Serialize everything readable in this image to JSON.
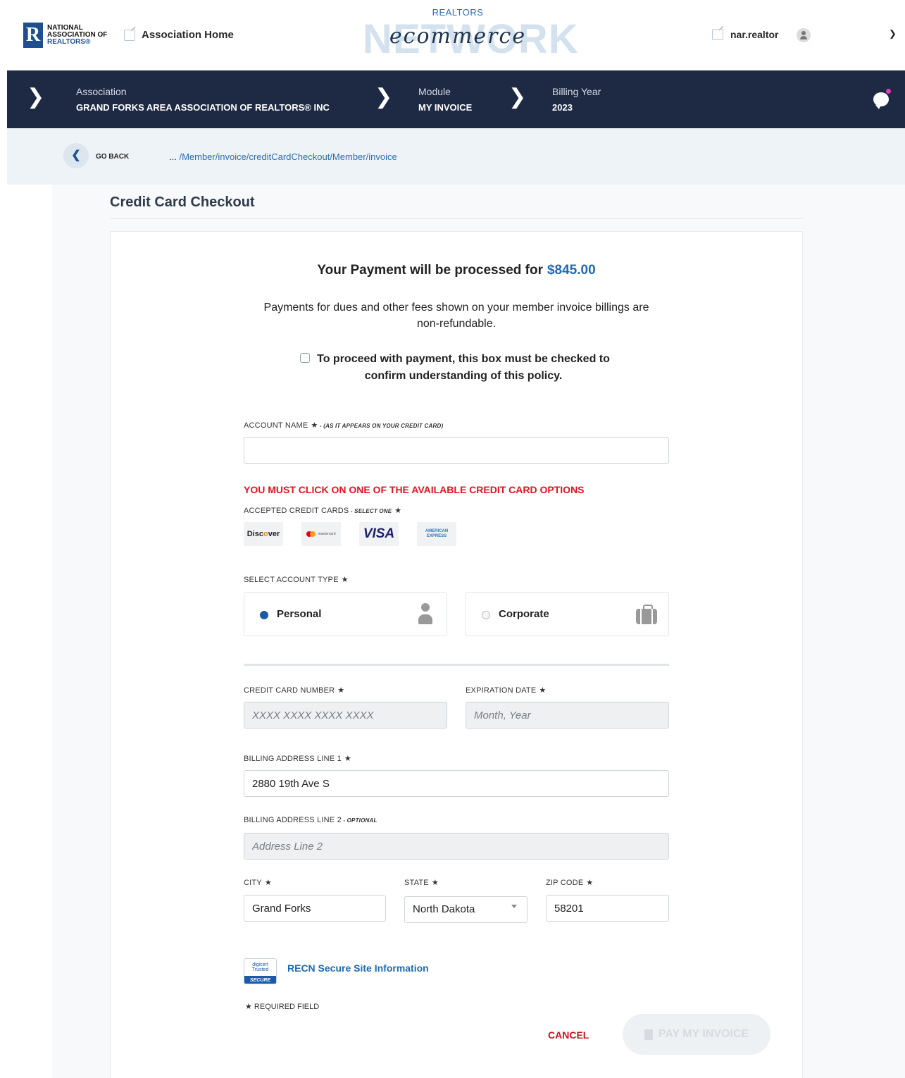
{
  "header": {
    "nar_logo_mark": "R",
    "nar_logo_line1": "NATIONAL",
    "nar_logo_line2": "ASSOCIATION OF",
    "nar_logo_line3": "REALTORS®",
    "association_home": "Association Home",
    "brand_top": "REALTORS",
    "brand_main": "NETWORK",
    "brand_script": "ecommerce",
    "username": "nar.realtor"
  },
  "nav": {
    "association_label": "Association",
    "association_value": "GRAND FORKS AREA ASSOCIATION OF REALTORS® INC",
    "module_label": "Module",
    "module_value": "MY INVOICE",
    "billing_year_label": "Billing Year",
    "billing_year_value": "2023"
  },
  "breadcrumb": {
    "go_back": "GO BACK",
    "ellipsis": "...",
    "path": " /Member/invoice/creditCardCheckout/Member/invoice"
  },
  "page": {
    "title": "Credit Card Checkout",
    "pay_prefix": "Your Payment will be processed for",
    "amount": "$845.00",
    "refund_notice": "Payments for dues and other fees shown on your member invoice billings are non-refundable.",
    "confirm_text": "To proceed with payment, this box must be checked to confirm understanding of this policy.",
    "confirm_checked": false
  },
  "form": {
    "account_name_label": "ACCOUNT NAME",
    "account_name_note": " - (AS IT APPEARS ON YOUR CREDIT CARD)",
    "account_name_value": "",
    "card_warning": "YOU MUST CLICK ON ONE OF THE AVAILABLE CREDIT CARD OPTIONS",
    "accepted_cards_label": "ACCEPTED CREDIT CARDS",
    "accepted_cards_note": " - SELECT ONE",
    "cards": {
      "discover_a": "Disc",
      "discover_o": "o",
      "discover_b": "ver",
      "mastercard": "mastercard",
      "visa": "VISA",
      "amex": "AMERICAN EXPRESS"
    },
    "account_type_label": "SELECT ACCOUNT TYPE",
    "account_types": [
      "Personal",
      "Corporate"
    ],
    "account_type_selected": "Personal",
    "cc_number_label": "CREDIT CARD NUMBER",
    "cc_number_placeholder": "XXXX XXXX XXXX XXXX",
    "expiration_label": "EXPIRATION DATE",
    "expiration_placeholder": "Month, Year",
    "address1_label": "BILLING ADDRESS LINE 1",
    "address1_value": "2880 19th Ave S",
    "address2_label": "BILLING ADDRESS LINE 2",
    "address2_note": " - OPTIONAL",
    "address2_placeholder": "Address Line 2",
    "city_label": "CITY",
    "city_value": "Grand Forks",
    "state_label": "STATE",
    "state_value": "North Dakota",
    "zip_label": "ZIP CODE",
    "zip_value": "58201",
    "star": "★"
  },
  "footer": {
    "digicert_top": "digicert Trusted",
    "digicert_bottom": "SECURE",
    "secure_link": "RECN Secure Site Information",
    "required_field": "★ REQUIRED FIELD",
    "cancel": "CANCEL",
    "pay_button": "PAY MY INVOICE"
  },
  "colors": {
    "nav_background": "#1e2a44",
    "accent_blue": "#1c6bb3",
    "warning_red": "#e0141b",
    "cancel_red": "#c4161c"
  }
}
